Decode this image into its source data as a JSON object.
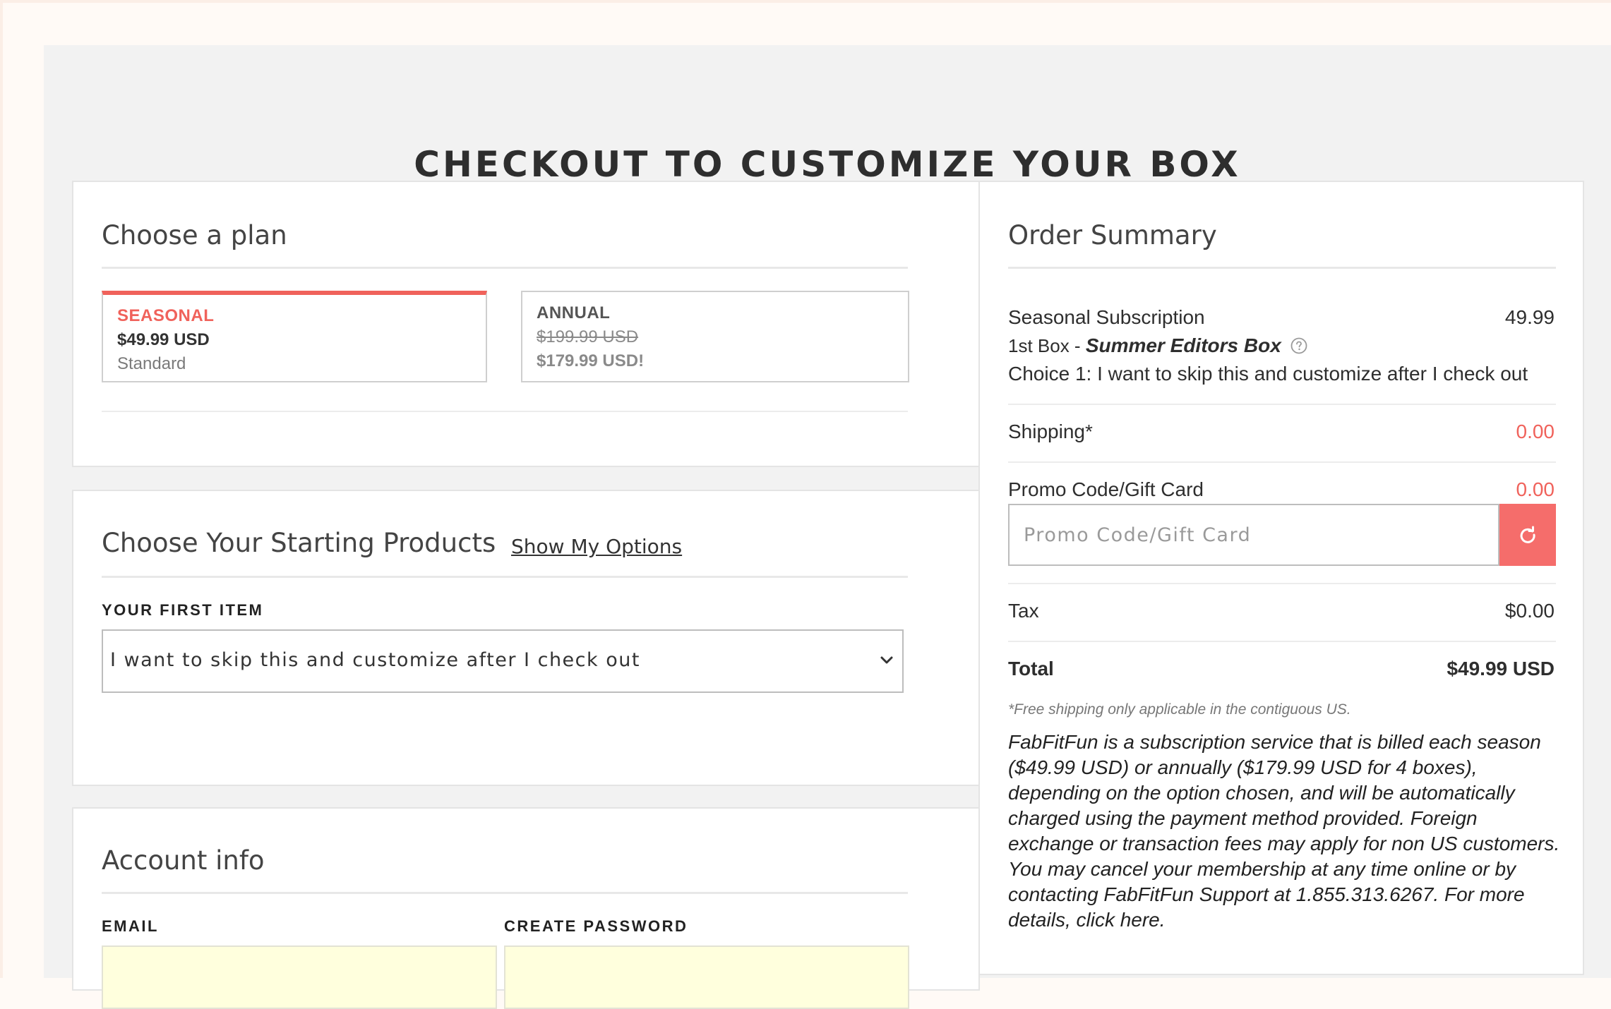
{
  "page": {
    "title": "CHECKOUT TO CUSTOMIZE YOUR BOX"
  },
  "plan": {
    "heading": "Choose a plan",
    "options": [
      {
        "name": "SEASONAL",
        "price": "$49.99 USD",
        "note": "Standard",
        "selected": true
      },
      {
        "name": "ANNUAL",
        "original_price": "$199.99 USD",
        "price": "$179.99 USD!",
        "selected": false
      }
    ]
  },
  "products": {
    "heading": "Choose Your Starting Products",
    "show_options_link": "Show My Options",
    "first_item_label": "YOUR FIRST ITEM",
    "first_item_value": "I want to skip this and customize after I check out"
  },
  "account": {
    "heading": "Account info",
    "email_label": "EMAIL",
    "password_label": "CREATE PASSWORD",
    "email_value": "",
    "password_value": ""
  },
  "summary": {
    "heading": "Order Summary",
    "subscription_label": "Seasonal Subscription",
    "subscription_value": "49.99",
    "first_box_prefix": "1st Box - ",
    "first_box_name": "Summer Editors Box",
    "choice_line": "Choice 1: I want to skip this and customize after I check out",
    "shipping_label": "Shipping*",
    "shipping_value": "0.00",
    "promo_label": "Promo Code/Gift Card",
    "promo_value": "0.00",
    "promo_placeholder": "Promo Code/Gift Card",
    "tax_label": "Tax",
    "tax_value": "$0.00",
    "total_label": "Total",
    "total_value": "$49.99 USD",
    "shipping_note": "*Free shipping only applicable in the contiguous US.",
    "disclaimer": "FabFitFun is a subscription service that is billed each season ($49.99 USD) or annually ($179.99 USD for 4 boxes), depending on the option chosen, and will be automatically charged using the payment method provided. Foreign exchange or transaction fees may apply for non US customers. You may cancel your membership at any time online or by contacting FabFitFun Support at 1.855.313.6267. For more details, click here."
  },
  "icons": {
    "help": "question-circle-icon",
    "refresh": "refresh-icon",
    "dropdown": "chevron-down-icon"
  },
  "colors": {
    "accent": "#f0625b",
    "button": "#f56d6b",
    "background": "#f2f2f2",
    "autofill": "#ffffdd"
  }
}
